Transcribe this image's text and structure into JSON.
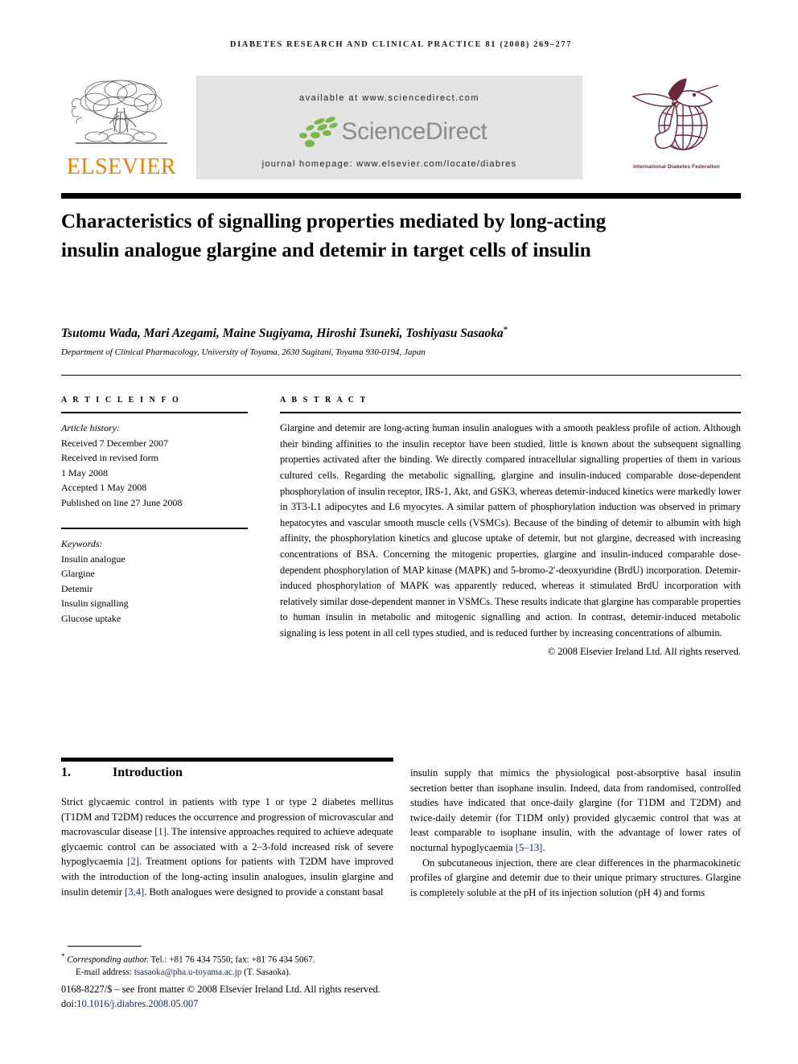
{
  "running_head": "DIABETES RESEARCH AND CLINICAL PRACTICE 81 (2008) 269–277",
  "masthead": {
    "elsevier_wordmark": "ELSEVIER",
    "available_at": "available at www.sciencedirect.com",
    "sciencedirect_wordmark": "ScienceDirect",
    "journal_homepage": "journal homepage: www.elsevier.com/locate/diabres",
    "idf_caption": "International Diabetes Federation",
    "colors": {
      "elsevier_orange": "#F08000",
      "sciencedirect_green": "#7AB648",
      "sciencedirect_gray": "#8A8A8A",
      "idf_maroon": "#6B2737",
      "banner_gray": "#E3E3E3",
      "link_blue": "#13296B"
    }
  },
  "article": {
    "title": "Characteristics of signalling properties mediated by long-acting insulin analogue glargine and detemir in target cells of insulin",
    "authors": "Tsutomu Wada, Mari Azegami, Maine Sugiyama, Hiroshi Tsuneki, Toshiyasu Sasaoka",
    "corresponding_marker": "*",
    "affiliation": "Department of Clinical Pharmacology, University of Toyama, 2630 Sugitani, Toyama 930-0194, Japan"
  },
  "article_info": {
    "heading": "A R T I C L E   I N F O",
    "history_label": "Article history:",
    "history": [
      "Received 7 December 2007",
      "Received in revised form",
      "1 May 2008",
      "Accepted 1 May 2008",
      "Published on line 27 June 2008"
    ],
    "keywords_label": "Keywords:",
    "keywords": [
      "Insulin analogue",
      "Glargine",
      "Detemir",
      "Insulin signalling",
      "Glucose uptake"
    ]
  },
  "abstract": {
    "heading": "A B S T R A C T",
    "body": "Glargine and detemir are long-acting human insulin analogues with a smooth peakless profile of action. Although their binding affinities to the insulin receptor have been studied, little is known about the subsequent signalling properties activated after the binding. We directly compared intracellular signalling properties of them in various cultured cells. Regarding the metabolic signalling, glargine and insulin-induced comparable dose-dependent phosphorylation of insulin receptor, IRS-1, Akt, and GSK3, whereas detemir-induced kinetics were markedly lower in 3T3-L1 adipocytes and L6 myocytes. A similar pattern of phosphorylation induction was observed in primary hepatocytes and vascular smooth muscle cells (VSMCs). Because of the binding of detemir to albumin with high affinity, the phosphorylation kinetics and glucose uptake of detemir, but not glargine, decreased with increasing concentrations of BSA. Concerning the mitogenic properties, glargine and insulin-induced comparable dose-dependent phosphorylation of MAP kinase (MAPK) and 5-bromo-2′-deoxyuridine (BrdU) incorporation. Detemir-induced phosphorylation of MAPK was apparently reduced, whereas it stimulated BrdU incorporation with relatively similar dose-dependent manner in VSMCs. These results indicate that glargine has comparable properties to human insulin in metabolic and mitogenic signalling and action. In contrast, detemir-induced metabolic signaling is less potent in all cell types studied, and is reduced further by increasing concentrations of albumin.",
    "copyright": "© 2008 Elsevier Ireland Ltd. All rights reserved."
  },
  "introduction": {
    "number": "1.",
    "heading": "Introduction",
    "left_paragraph_1_a": "Strict glycaemic control in patients with type 1 or type 2 diabetes mellitus (T1DM and T2DM) reduces the occurrence and progression of microvascular and macrovascular disease ",
    "cite_1": "[1]",
    "left_paragraph_1_b": ". The intensive approaches required to achieve adequate glycaemic control can be associated with a 2–3-fold increased risk of severe hypoglycaemia ",
    "cite_2": "[2]",
    "left_paragraph_1_c": ". Treatment options for patients with T2DM have improved with the introduction of the long-acting insulin analogues, insulin glargine and insulin detemir ",
    "cite_34": "[3,4]",
    "left_paragraph_1_d": ". Both analogues were designed to provide a constant basal",
    "right_paragraph_1_a": "insulin supply that mimics the physiological post-absorptive basal insulin secretion better than isophane insulin. Indeed, data from randomised, controlled studies have indicated that once-daily glargine (for T1DM and T2DM) and twice-daily detemir (for T1DM only) provided glycaemic control that was at least comparable to isophane insulin, with the advantage of lower rates of nocturnal hypoglycaemia ",
    "cite_513": "[5–13]",
    "right_paragraph_1_b": ".",
    "right_paragraph_2": "On subcutaneous injection, there are clear differences in the pharmacokinetic profiles of glargine and detemir due to their unique primary structures. Glargine is completely soluble at the pH of its injection solution (pH 4) and forms"
  },
  "footnote": {
    "corresponding_marker": "*",
    "corresponding_label": "Corresponding author.",
    "corresponding_contact": " Tel.: +81 76 434 7550; fax: +81 76 434 5067.",
    "email_label": "E-mail address:",
    "email": "tsasaoka@pha.u-toyama.ac.jp",
    "email_suffix": "(T. Sasaoka).",
    "issn_line_a": "0168-8227/$ – see front matter © 2008 Elsevier Ireland Ltd. All rights reserved.",
    "doi_label": "doi:",
    "doi": "10.1016/j.diabres.2008.05.007"
  }
}
